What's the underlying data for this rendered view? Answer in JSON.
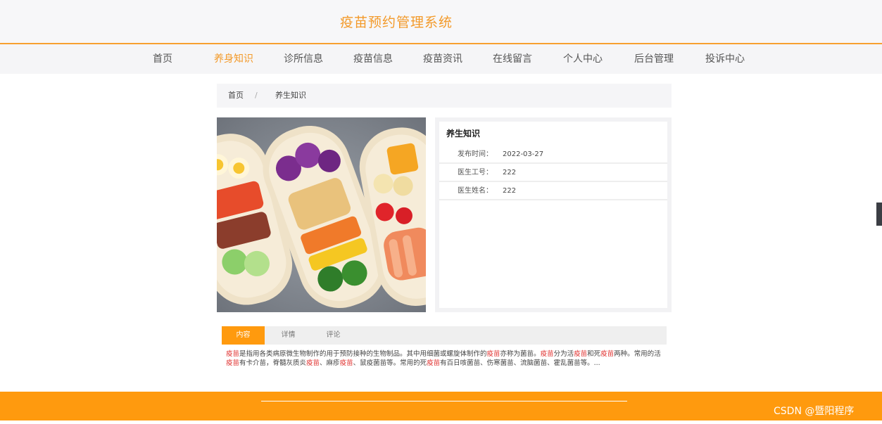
{
  "header": {
    "site_title": "疫苗预约管理系统"
  },
  "nav": {
    "items": [
      {
        "label": "首页"
      },
      {
        "label": "养身知识"
      },
      {
        "label": "诊所信息"
      },
      {
        "label": "疫苗信息"
      },
      {
        "label": "疫苗资讯"
      },
      {
        "label": "在线留言"
      },
      {
        "label": "个人中心"
      },
      {
        "label": "后台管理"
      },
      {
        "label": "投诉中心"
      }
    ],
    "active_index": 1
  },
  "breadcrumb": {
    "home": "首页",
    "separator": "/",
    "current": "养生知识"
  },
  "info": {
    "title": "养生知识",
    "rows": [
      {
        "key": "发布时间：",
        "value": "2022-03-27"
      },
      {
        "key": "医生工号：",
        "value": "222"
      },
      {
        "key": "医生姓名：",
        "value": "222"
      }
    ]
  },
  "tabs": [
    {
      "label": "内容"
    },
    {
      "label": "详情"
    },
    {
      "label": "评论"
    }
  ],
  "content": {
    "segments": [
      {
        "t": "疫苗",
        "hl": true
      },
      {
        "t": "是指用各类病原微生物制作的用于预防接种的生物制品。其中用细菌或螺旋体制作的",
        "hl": false
      },
      {
        "t": "疫苗",
        "hl": true
      },
      {
        "t": "亦称为菌苗。",
        "hl": false
      },
      {
        "t": "疫苗",
        "hl": true
      },
      {
        "t": "分为活",
        "hl": false
      },
      {
        "t": "疫苗",
        "hl": true
      },
      {
        "t": "和死",
        "hl": false
      },
      {
        "t": "疫苗",
        "hl": true
      },
      {
        "t": "两种。常用的活",
        "hl": false
      },
      {
        "t": "疫苗",
        "hl": true
      },
      {
        "t": "有卡介苗，脊髓灰质炎",
        "hl": false
      },
      {
        "t": "疫苗",
        "hl": true
      },
      {
        "t": "、麻疹",
        "hl": false
      },
      {
        "t": "疫苗",
        "hl": true
      },
      {
        "t": "、鼠疫菌苗等。常用的死",
        "hl": false
      },
      {
        "t": "疫苗",
        "hl": true
      },
      {
        "t": "有百日咳菌苗、伤寒菌苗、流脑菌苗、霍乱菌苗等。...",
        "hl": false
      }
    ]
  },
  "footer": {
    "watermark": "CSDN @暨阳程序"
  },
  "colors": {
    "accent": "#ff9a0e",
    "title": "#f39a2a",
    "highlight": "#e0312f"
  }
}
